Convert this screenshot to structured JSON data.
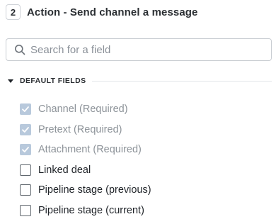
{
  "header": {
    "step_number": "2",
    "title": "Action - Send channel a message"
  },
  "search": {
    "placeholder": "Search for a field",
    "value": "",
    "icon": "search-icon"
  },
  "section": {
    "title": "DEFAULT FIELDS",
    "expanded": true
  },
  "fields": [
    {
      "label": "Channel (Required)",
      "checked": true,
      "disabled": true
    },
    {
      "label": "Pretext (Required)",
      "checked": true,
      "disabled": true
    },
    {
      "label": "Attachment (Required)",
      "checked": true,
      "disabled": true
    },
    {
      "label": "Linked deal",
      "checked": false,
      "disabled": false
    },
    {
      "label": "Pipeline stage (previous)",
      "checked": false,
      "disabled": false
    },
    {
      "label": "Pipeline stage (current)",
      "checked": false,
      "disabled": false
    }
  ],
  "colors": {
    "checked_disabled": "#b8c9dc",
    "border": "#c9cdd2",
    "muted_text": "#8d9399"
  }
}
